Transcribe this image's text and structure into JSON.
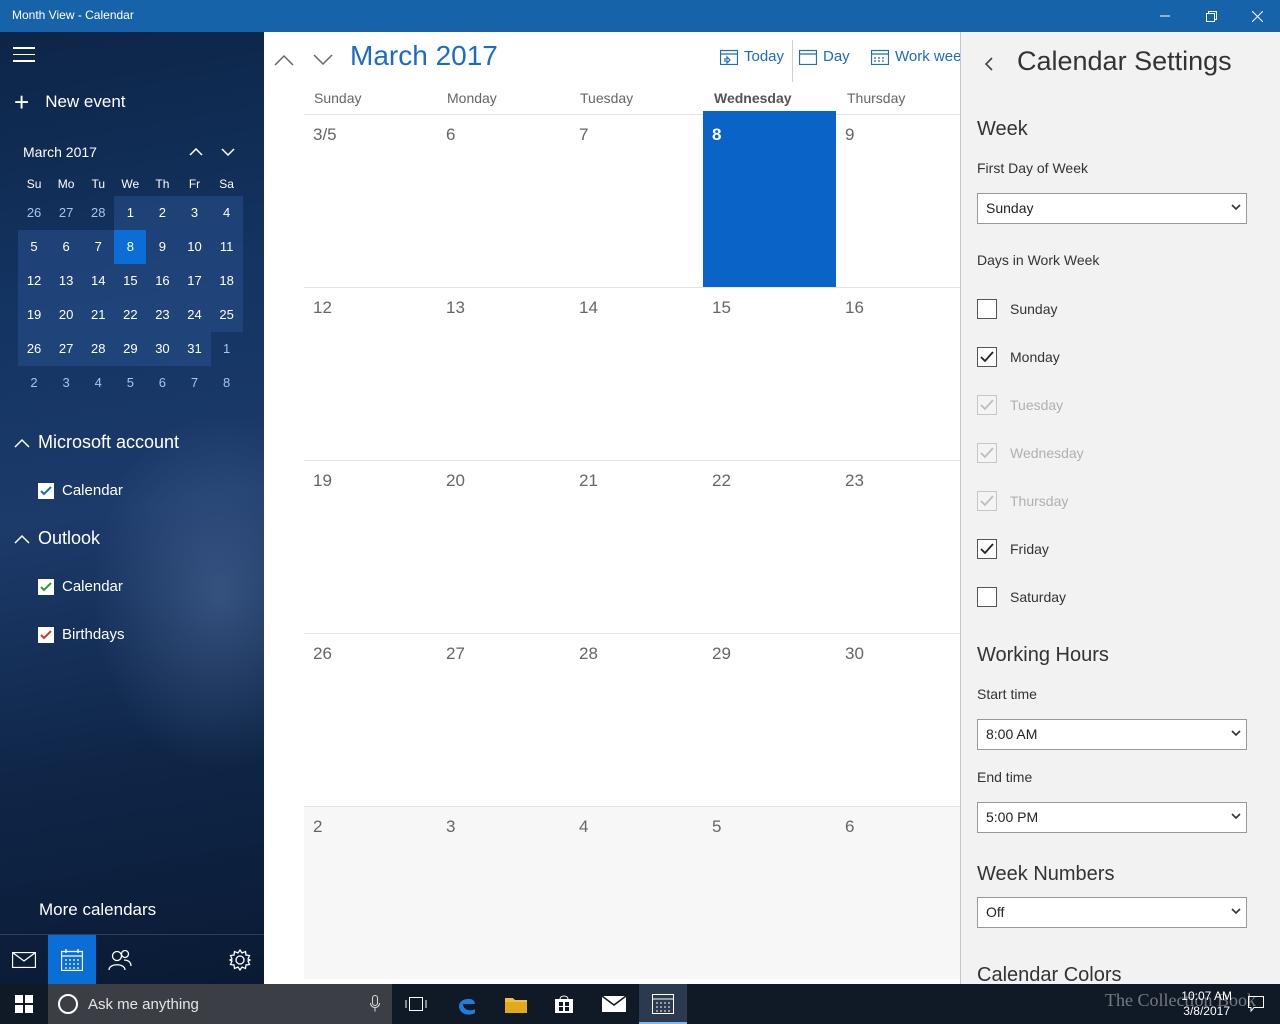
{
  "window": {
    "title": "Month View - Calendar"
  },
  "sidebar": {
    "new_event": "New event",
    "mini_month": "March 2017",
    "mini_dow": [
      "Su",
      "Mo",
      "Tu",
      "We",
      "Th",
      "Fr",
      "Sa"
    ],
    "mini_weeks": [
      [
        "26",
        "27",
        "28",
        "1",
        "2",
        "3",
        "4"
      ],
      [
        "5",
        "6",
        "7",
        "8",
        "9",
        "10",
        "11"
      ],
      [
        "12",
        "13",
        "14",
        "15",
        "16",
        "17",
        "18"
      ],
      [
        "19",
        "20",
        "21",
        "22",
        "23",
        "24",
        "25"
      ],
      [
        "26",
        "27",
        "28",
        "29",
        "30",
        "31",
        "1"
      ],
      [
        "2",
        "3",
        "4",
        "5",
        "6",
        "7",
        "8"
      ]
    ],
    "accounts": [
      {
        "name": "Microsoft account",
        "calendars": [
          {
            "name": "Calendar",
            "color": "#1a6cd4"
          }
        ]
      },
      {
        "name": "Outlook",
        "calendars": [
          {
            "name": "Calendar",
            "color": "#2a9d3a"
          },
          {
            "name": "Birthdays",
            "color": "#d03a2a"
          }
        ]
      }
    ],
    "more_calendars": "More calendars"
  },
  "main": {
    "month_title": "March 2017",
    "views": {
      "today": "Today",
      "day": "Day",
      "work_week": "Work week"
    },
    "dow": [
      "Sunday",
      "Monday",
      "Tuesday",
      "Wednesday",
      "Thursday"
    ],
    "weeks": [
      [
        "3/5",
        "6",
        "7",
        "8",
        "9"
      ],
      [
        "12",
        "13",
        "14",
        "15",
        "16"
      ],
      [
        "19",
        "20",
        "21",
        "22",
        "23"
      ],
      [
        "26",
        "27",
        "28",
        "29",
        "30"
      ],
      [
        "2",
        "3",
        "4",
        "5",
        "6"
      ]
    ]
  },
  "settings": {
    "title": "Calendar Settings",
    "week_heading": "Week",
    "first_day_label": "First Day of Week",
    "first_day_value": "Sunday",
    "work_week_label": "Days in Work Week",
    "work_days": [
      {
        "name": "Sunday",
        "checked": false,
        "disabled": false
      },
      {
        "name": "Monday",
        "checked": true,
        "disabled": false
      },
      {
        "name": "Tuesday",
        "checked": true,
        "disabled": true
      },
      {
        "name": "Wednesday",
        "checked": true,
        "disabled": true
      },
      {
        "name": "Thursday",
        "checked": true,
        "disabled": true
      },
      {
        "name": "Friday",
        "checked": true,
        "disabled": false
      },
      {
        "name": "Saturday",
        "checked": false,
        "disabled": false
      }
    ],
    "working_hours_heading": "Working Hours",
    "start_label": "Start time",
    "start_value": "8:00 AM",
    "end_label": "End time",
    "end_value": "5:00 PM",
    "week_numbers_heading": "Week Numbers",
    "week_numbers_value": "Off",
    "calendar_colors_heading": "Calendar Colors"
  },
  "taskbar": {
    "search_placeholder": "Ask me anything",
    "time": "10:07 AM",
    "date": "3/8/2017",
    "watermark": "The Collection Book"
  }
}
